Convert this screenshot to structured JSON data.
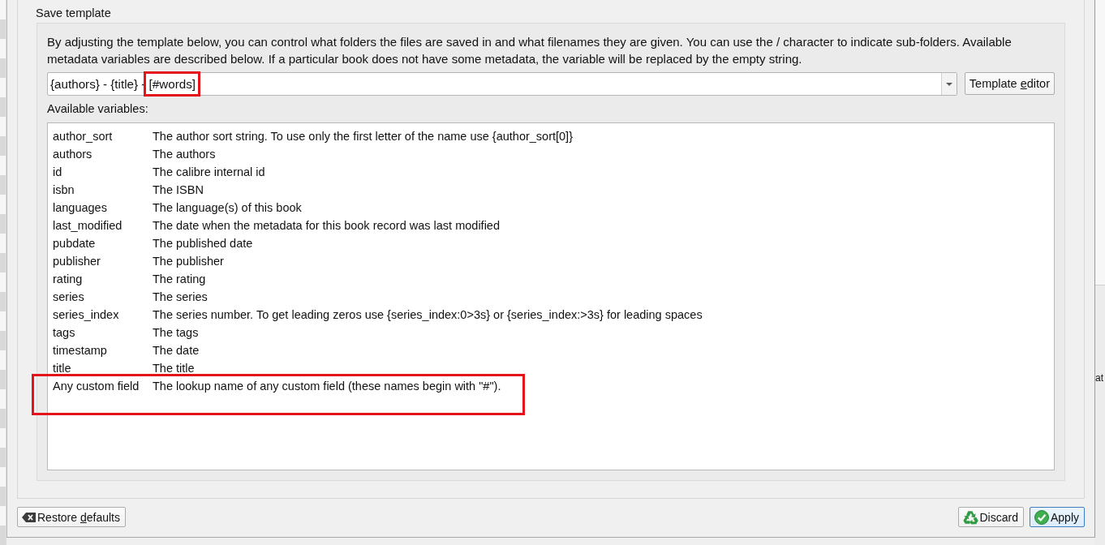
{
  "background_window": {
    "fragment_text": "at"
  },
  "save_template": {
    "title": "Save template",
    "description": "By adjusting the template below, you can control what folders the files are saved in and what filenames they are given. You can use the / character to indicate sub-folders. Available metadata variables are described below. If a particular book does not have some metadata, the variable will be replaced by the empty string.",
    "template_field": {
      "value_parts": [
        {
          "text": "{authors} - {title} - ",
          "highlighted": false
        },
        {
          "text": "[#words]",
          "highlighted": true
        }
      ]
    },
    "template_editor_button": {
      "label_parts": [
        {
          "text": "Template ",
          "underlined": false
        },
        {
          "text": "e",
          "underlined": true
        },
        {
          "text": "ditor",
          "underlined": false
        }
      ]
    },
    "variables_label": "Available variables:",
    "variables": [
      {
        "name": "author_sort",
        "description": "The author sort string. To use only the first letter of the name use {author_sort[0]}",
        "highlighted": false
      },
      {
        "name": "authors",
        "description": "The authors",
        "highlighted": false
      },
      {
        "name": "id",
        "description": "The calibre internal id",
        "highlighted": false
      },
      {
        "name": "isbn",
        "description": "The ISBN",
        "highlighted": false
      },
      {
        "name": "languages",
        "description": "The language(s) of this book",
        "highlighted": false
      },
      {
        "name": "last_modified",
        "description": "The date when the metadata for this book record was last modified",
        "highlighted": false
      },
      {
        "name": "pubdate",
        "description": "The published date",
        "highlighted": false
      },
      {
        "name": "publisher",
        "description": "The publisher",
        "highlighted": false
      },
      {
        "name": "rating",
        "description": "The rating",
        "highlighted": false
      },
      {
        "name": "series",
        "description": "The series",
        "highlighted": false
      },
      {
        "name": "series_index",
        "description": "The series number. To get leading zeros use {series_index:0>3s} or {series_index:>3s} for leading spaces",
        "highlighted": false
      },
      {
        "name": "tags",
        "description": "The tags",
        "highlighted": false
      },
      {
        "name": "timestamp",
        "description": "The date",
        "highlighted": false
      },
      {
        "name": "title",
        "description": "The title",
        "highlighted": false
      },
      {
        "name": "Any custom field",
        "description": "The lookup name of any custom field (these names begin with \"#\").",
        "highlighted": true
      }
    ]
  },
  "footer": {
    "left_buttons": [
      {
        "kind": "restore",
        "default": false,
        "label_parts": [
          {
            "text": "Restore ",
            "underlined": false
          },
          {
            "text": "d",
            "underlined": true
          },
          {
            "text": "efaults",
            "underlined": false
          }
        ]
      }
    ],
    "right_buttons": [
      {
        "kind": "discard",
        "default": false,
        "label_parts": [
          {
            "text": "Discard",
            "underlined": false
          }
        ]
      },
      {
        "kind": "apply",
        "default": true,
        "label_parts": [
          {
            "text": "Apply",
            "underlined": false
          }
        ]
      }
    ]
  }
}
